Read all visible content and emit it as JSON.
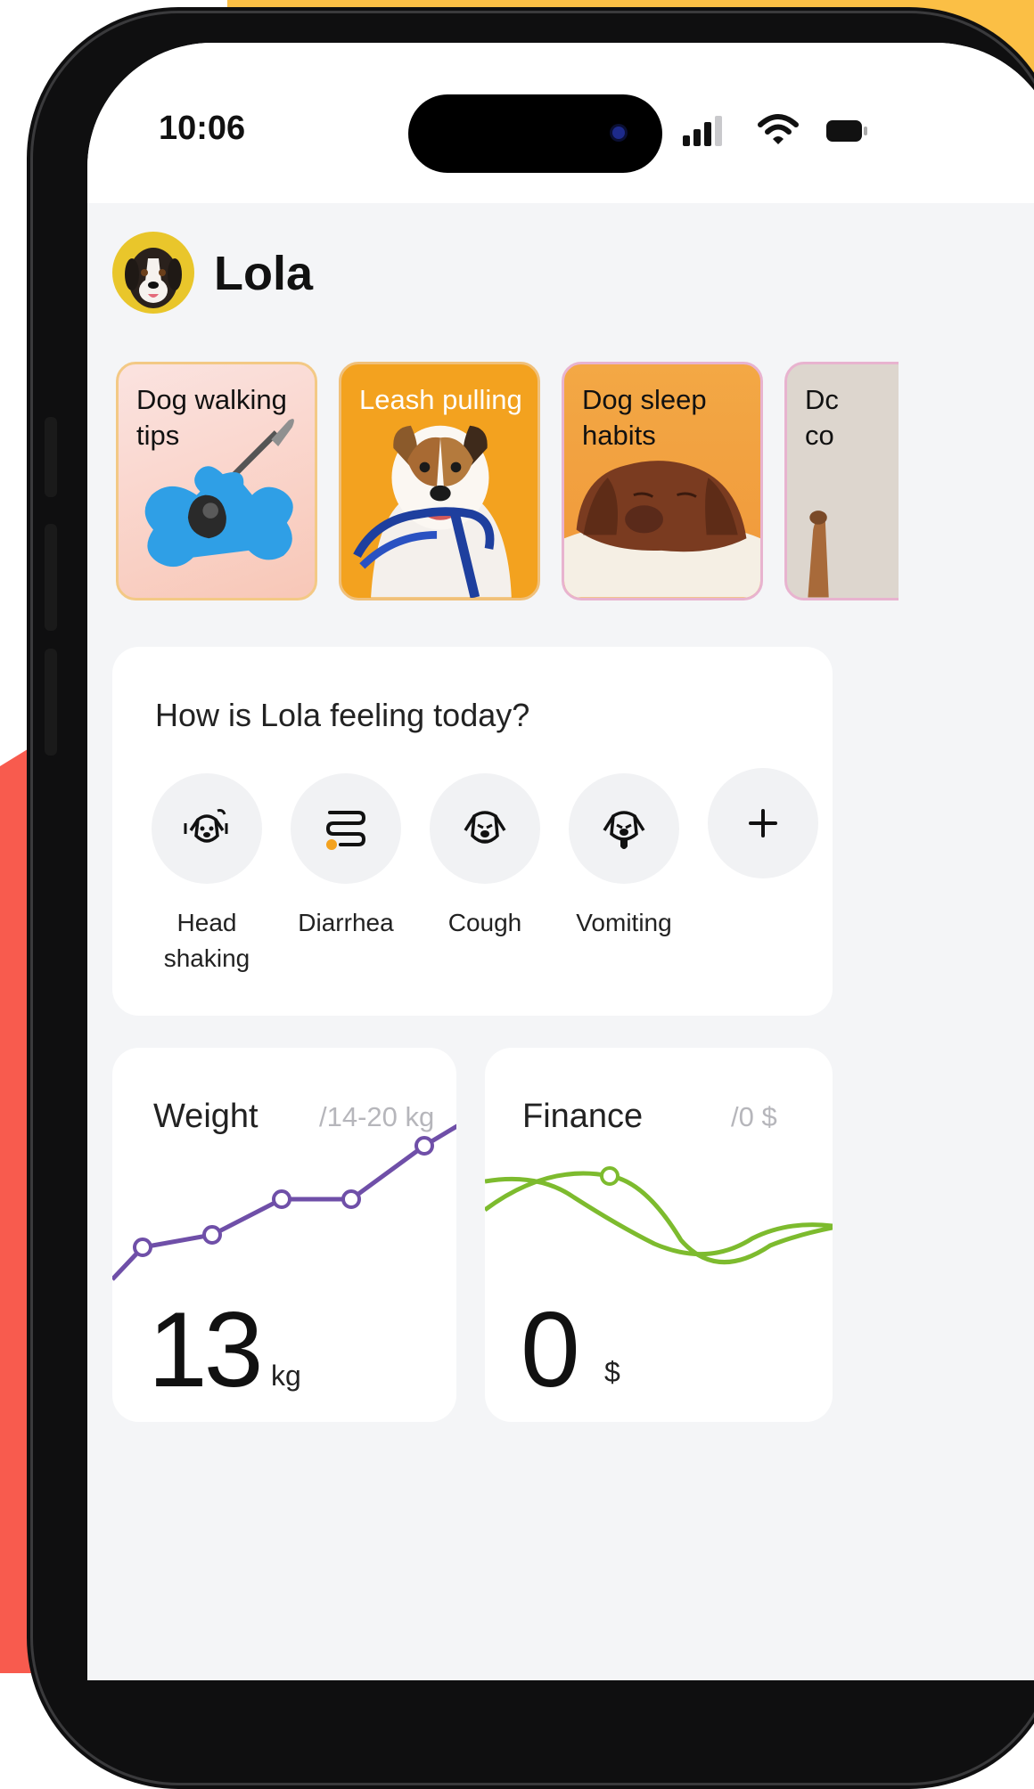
{
  "status_bar": {
    "time": "10:06"
  },
  "pet": {
    "name": "Lola"
  },
  "cards": [
    {
      "title": "Dog walking tips"
    },
    {
      "title": "Leash pulling"
    },
    {
      "title": "Dog sleep habits"
    },
    {
      "title": "Dc co"
    }
  ],
  "feeling": {
    "question": "How is Lola feeling today?",
    "symptoms": [
      {
        "label": "Head shaking",
        "icon": "dog-head-shaking-icon"
      },
      {
        "label": "Diarrhea",
        "icon": "intestine-icon"
      },
      {
        "label": "Cough",
        "icon": "dog-cough-icon"
      },
      {
        "label": "Vomiting",
        "icon": "dog-vomiting-icon"
      },
      {
        "label": "",
        "icon": "plus-icon"
      }
    ]
  },
  "weight": {
    "title": "Weight",
    "range": "/14-20 kg",
    "value": "13",
    "unit": "kg"
  },
  "finance": {
    "title": "Finance",
    "range": "/0 $",
    "value": "0",
    "unit": "$"
  },
  "colors": {
    "weight_line": "#6f4fa8",
    "finance_line": "#7dbb2e",
    "accent_orange": "#f3a21f"
  }
}
